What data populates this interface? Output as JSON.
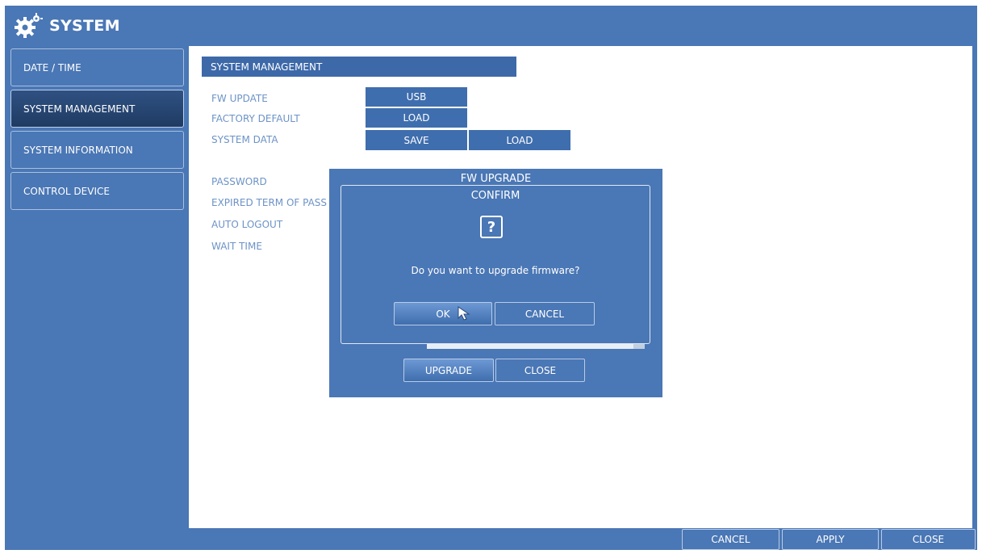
{
  "header": {
    "title": "SYSTEM",
    "icon": "gear-icon"
  },
  "sidebar": {
    "items": [
      {
        "label": "DATE / TIME"
      },
      {
        "label": "SYSTEM MANAGEMENT",
        "active": true
      },
      {
        "label": "SYSTEM INFORMATION"
      },
      {
        "label": "CONTROL DEVICE"
      }
    ]
  },
  "main": {
    "section_title": "SYSTEM MANAGEMENT",
    "rows": [
      {
        "label": "FW UPDATE",
        "buttons": [
          "USB"
        ]
      },
      {
        "label": "FACTORY DEFAULT",
        "buttons": [
          "LOAD"
        ]
      },
      {
        "label": "SYSTEM DATA",
        "buttons": [
          "SAVE",
          "LOAD"
        ]
      }
    ],
    "settings_labels": [
      "PASSWORD",
      "EXPIRED TERM OF PASS",
      "AUTO LOGOUT",
      "WAIT TIME"
    ]
  },
  "fw_upgrade_dialog": {
    "title": "FW UPGRADE",
    "upgrade_label": "UPGRADE",
    "close_label": "CLOSE"
  },
  "confirm_dialog": {
    "title": "CONFIRM",
    "icon": "question-icon",
    "icon_glyph": "?",
    "message": "Do you want to upgrade firmware?",
    "ok_label": "OK",
    "cancel_label": "CANCEL"
  },
  "footer": {
    "cancel_label": "CANCEL",
    "apply_label": "APPLY",
    "close_label": "CLOSE"
  },
  "colors": {
    "frame_blue": "#4a77b5",
    "active_nav": "#1f3b63",
    "label_blue": "#6d93c7",
    "button_blue": "#3f6eae"
  }
}
